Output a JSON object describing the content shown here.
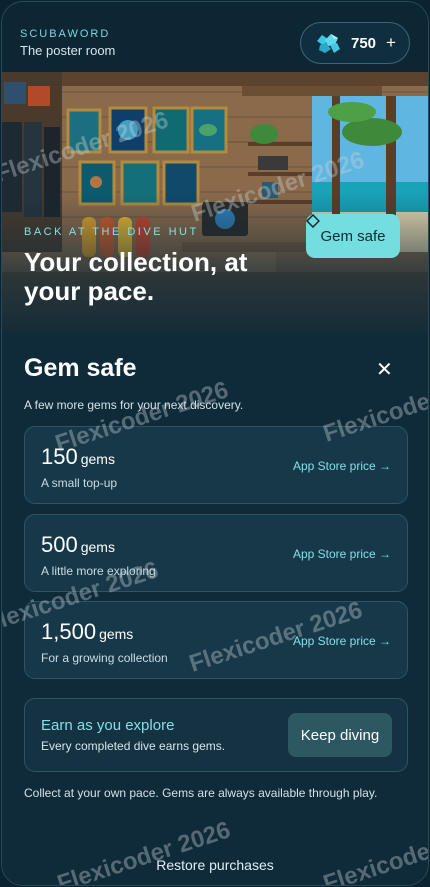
{
  "header": {
    "brand": "SCUBAWORD",
    "subtitle": "The poster room",
    "gem_count": "750",
    "plus": "+",
    "gem_icon": "gem-cluster-icon"
  },
  "hero": {
    "kicker": "BACK AT THE DIVE HUT",
    "title": "Your collection, at your pace.",
    "gem_safe_button": "Gem safe",
    "gem_safe_icon": "diamond-outline-icon"
  },
  "sheet": {
    "title": "Gem safe",
    "close_icon": "close-icon",
    "subtitle": "A few more gems for your next discovery.",
    "packs": [
      {
        "amount": "150",
        "unit": "gems",
        "desc": "A small top-up",
        "price": "App Store price →"
      },
      {
        "amount": "500",
        "unit": "gems",
        "desc": "A little more exploring",
        "price": "App Store price →"
      },
      {
        "amount": "1,500",
        "unit": "gems",
        "desc": "For a growing collection",
        "price": "App Store price →"
      }
    ],
    "earn": {
      "title": "Earn as you explore",
      "desc": "Every completed dive earns gems.",
      "button": "Keep diving"
    },
    "footnote": "Collect at your own pace. Gems are always available through play.",
    "restore": "Restore purchases"
  },
  "watermark": "Flexicoder 2026",
  "colors": {
    "accent": "#7fe0e6",
    "button_bg": "#74dde0",
    "background": "#0f2a38",
    "card": "#173848"
  }
}
